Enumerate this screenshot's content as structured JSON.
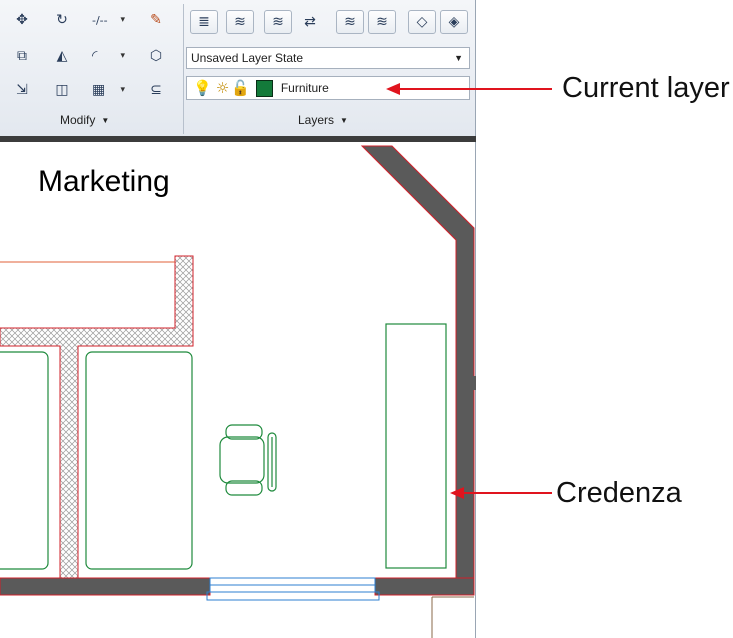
{
  "ribbon": {
    "modify_panel_title": "Modify",
    "layers_panel_title": "Layers",
    "layer_state_value": "Unsaved Layer State",
    "current_layer_name": "Furniture",
    "current_layer_color": "#137a3a",
    "modify_tools": [
      {
        "icon": "move-icon",
        "glyph": "✥"
      },
      {
        "icon": "rotate-icon",
        "glyph": "↻"
      },
      {
        "icon": "trim-icon",
        "glyph": "-/--"
      },
      {
        "icon": "erase-icon",
        "glyph": "✎"
      },
      {
        "icon": "copy-icon",
        "glyph": "⧉"
      },
      {
        "icon": "mirror-icon",
        "glyph": "◭"
      },
      {
        "icon": "fillet-icon",
        "glyph": "◜"
      },
      {
        "icon": "explode-icon",
        "glyph": "⬡"
      },
      {
        "icon": "stretch-icon",
        "glyph": "⇲"
      },
      {
        "icon": "scale-icon",
        "glyph": "◫"
      },
      {
        "icon": "array-icon",
        "glyph": "▦"
      },
      {
        "icon": "offset-icon",
        "glyph": "⊆"
      }
    ],
    "layer_tools": [
      {
        "icon": "layer-properties-icon",
        "glyph": "≣"
      },
      {
        "icon": "make-current-icon",
        "glyph": "≋"
      },
      {
        "icon": "match-layer-icon",
        "glyph": "≋"
      },
      {
        "icon": "previous-layer-icon",
        "glyph": "⇄"
      },
      {
        "icon": "isolate-layer-icon",
        "glyph": "≋"
      },
      {
        "icon": "unisolate-layer-icon",
        "glyph": "≋"
      },
      {
        "icon": "freeze-layer-icon",
        "glyph": "◇"
      },
      {
        "icon": "off-layer-icon",
        "glyph": "◈"
      }
    ]
  },
  "drawing": {
    "room_label": "Marketing"
  },
  "callouts": {
    "current_layer": "Current layer",
    "credenza": "Credenza",
    "arrow_color": "#e0141e"
  }
}
